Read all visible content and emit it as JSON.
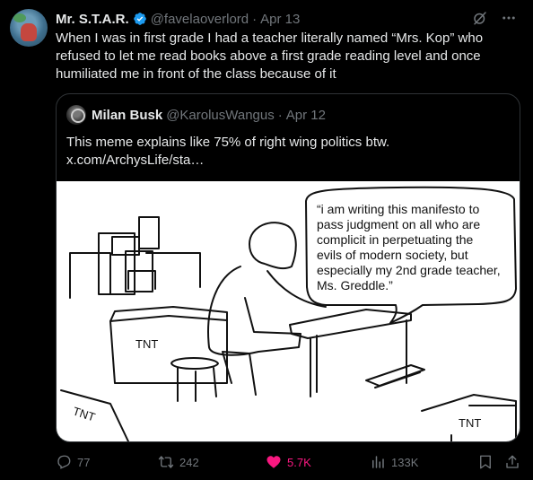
{
  "tweet": {
    "display_name": "Mr. S.T.A.R.",
    "handle": "@favelaoverlord",
    "separator": "·",
    "date": "Apr 13",
    "text": "When I was in first grade I had a teacher literally named “Mrs. Kop” who refused to let me read books above a first grade reading level and once humiliated me in front of the class because of it"
  },
  "quoted": {
    "display_name": "Milan Busk",
    "handle": "@KarolusWangus",
    "separator": "·",
    "date": "Apr 12",
    "text": "This meme explains like 75% of right wing politics btw.",
    "link": "x.com/ArchysLife/sta…",
    "meme": {
      "caption": "“i am writing this manifesto to pass judgment on all who are complicit in perpetuating the evils of modern society, but especially my 2nd grade teacher, Ms. Greddle.”",
      "crate_label_1": "TNT",
      "crate_label_2": "TNT",
      "crate_label_3": "TNT"
    }
  },
  "actions": {
    "replies": "77",
    "reposts": "242",
    "likes": "5.7K",
    "views": "133K"
  },
  "icons": [
    "verified-badge-icon",
    "grok-icon",
    "more-icon",
    "reply-icon",
    "repost-icon",
    "heart-icon",
    "views-icon",
    "bookmark-icon",
    "share-icon"
  ],
  "colors": {
    "background": "#000000",
    "text": "#e7e9ea",
    "muted": "#71767b",
    "verified": "#1d9bf0",
    "like": "#f91880",
    "border": "#2f3336"
  }
}
